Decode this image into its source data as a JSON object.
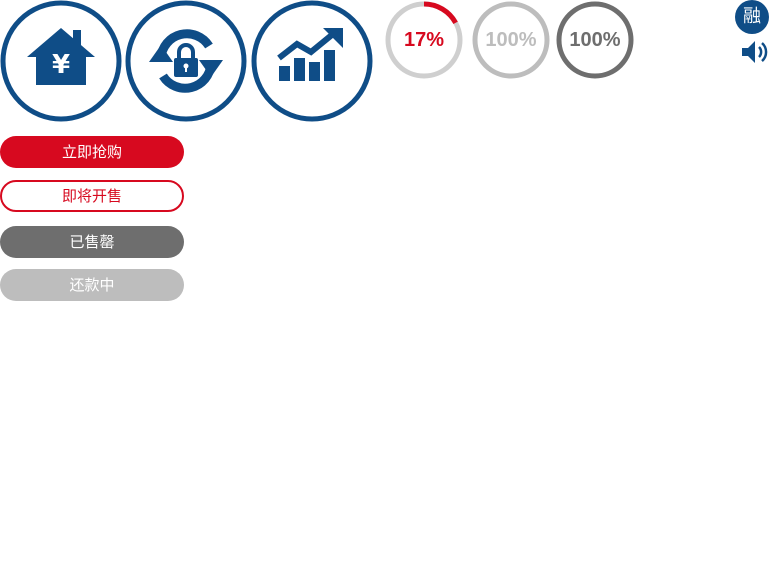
{
  "colors": {
    "brand_blue": "#0f4d87",
    "red": "#d7091f",
    "ring_track": "#cfcfcf",
    "gray_light": "#bdbdbd",
    "gray_dark": "#6e6e6e"
  },
  "icons": [
    {
      "name": "house-yen-icon"
    },
    {
      "name": "lock-refresh-icon"
    },
    {
      "name": "growth-chart-icon"
    }
  ],
  "progress_rings": [
    {
      "label": "17%",
      "value": 0.17,
      "status": "selling"
    },
    {
      "label": "100%",
      "value": 1.0,
      "status": "repaying"
    },
    {
      "label": "100%",
      "value": 1.0,
      "status": "sold_out"
    }
  ],
  "buttons": {
    "buy_now": "立即抢购",
    "coming_soon": "即将开售",
    "sold_out": "已售罄",
    "repaying": "还款中"
  },
  "badge": {
    "text": "融",
    "icon": "rong-badge-icon"
  },
  "speaker": {
    "icon": "speaker-icon"
  }
}
